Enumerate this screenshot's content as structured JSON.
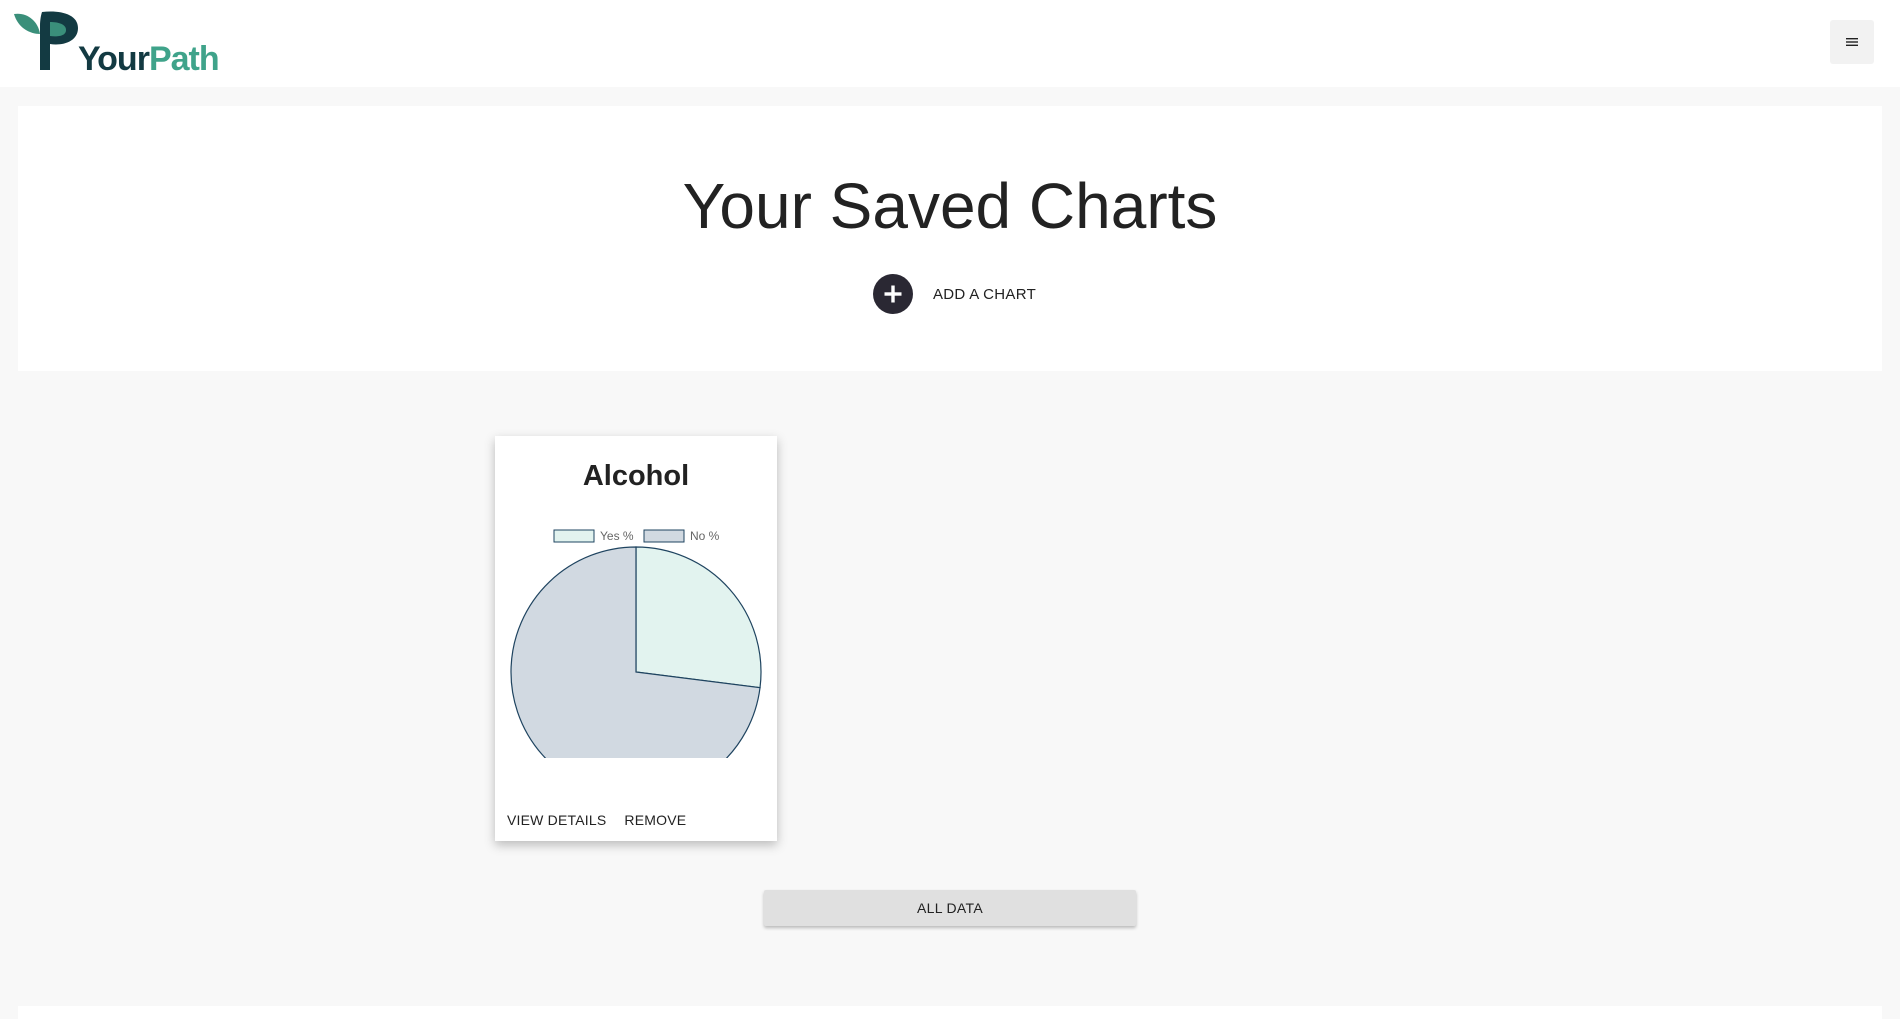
{
  "header": {
    "logo_your": "Your",
    "logo_path": "Path",
    "menu_icon": "hamburger-icon"
  },
  "hero": {
    "title": "Your Saved Charts",
    "add_chart_label": "ADD A CHART",
    "add_icon": "plus-circle-icon"
  },
  "cards": [
    {
      "title": "Alcohol",
      "view_details_label": "VIEW DETAILS",
      "remove_label": "REMOVE"
    }
  ],
  "chart_data": {
    "type": "pie",
    "title": "Alcohol",
    "legend_placement": "top",
    "series": [
      {
        "name": "Yes %",
        "value": 27,
        "color": "#e2f3ef"
      },
      {
        "name": "No %",
        "value": 73,
        "color": "#d1d9e1"
      }
    ],
    "border_color": "#1f4460"
  },
  "actions": {
    "all_data_label": "ALL DATA"
  },
  "colors": {
    "background": "#f8f8f8",
    "brand_dark": "#133a42",
    "brand_green": "#3fa38a",
    "add_button": "#2a2833"
  }
}
